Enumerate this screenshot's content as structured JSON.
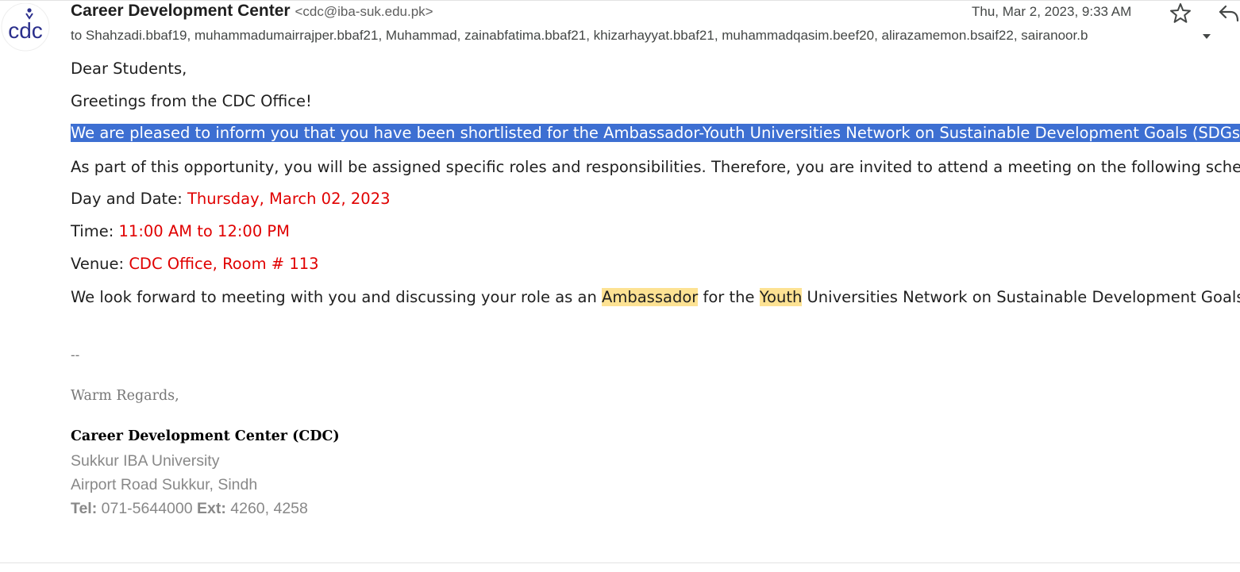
{
  "email": {
    "sender_name": "Career Development Center",
    "sender_email": "<cdc@iba-suk.edu.pk>",
    "recipients": "to Shahzadi.bbaf19, muhammadumairrajper.bbaf21, Muhammad, zainabfatima.bbaf21, khizarhayyat.bbaf21, muhammadqasim.beef20, alirazamemon.bsaif22, sairanoor.b",
    "date": "Thu, Mar 2, 2023, 9:33 AM",
    "avatar_text": "cdc",
    "icons": {
      "star": "star-icon",
      "reply": "reply-icon",
      "expand": "chevron-down-icon"
    }
  },
  "body": {
    "greeting": "Dear Students,",
    "intro": "Greetings from the CDC Office!",
    "selected_line": "We are pleased to inform you that you have been shortlisted for the Ambassador-Youth Universities Network on Sustainable Development Goals (SDGs).",
    "opportunity": "As part of this opportunity, you will be assigned specific roles and responsibilities. Therefore, you are invited to attend a meeting on the following schedule:",
    "day_label": "Day and Date: ",
    "day_value": "Thursday, March 02, 2023",
    "time_label": "Time: ",
    "time_value": "11:00 AM to 12:00 PM",
    "venue_label": "Venue: ",
    "venue_value": "CDC Office, Room # 113",
    "closing_pre": "We look forward to meeting with you and discussing your role as an ",
    "closing_hl1": "Ambassador",
    "closing_mid": " for the ",
    "closing_hl2": "Youth",
    "closing_post": " Universities Network on Sustainable Development Goals."
  },
  "signature": {
    "dash": "--",
    "regards": "Warm Regards,",
    "org": "Career Development Center (CDC)",
    "university": "Sukkur IBA University",
    "address": "Airport Road Sukkur, Sindh",
    "tel_label": "Tel:",
    "tel_value": " 071-5644000 ",
    "ext_label": "Ext:",
    "ext_value": " 4260, 4258"
  },
  "colors": {
    "selection": "#3d6fd2",
    "schedule_red": "#e00000",
    "search_highlight": "#fde293",
    "avatar_blue": "#2b2f8c"
  }
}
